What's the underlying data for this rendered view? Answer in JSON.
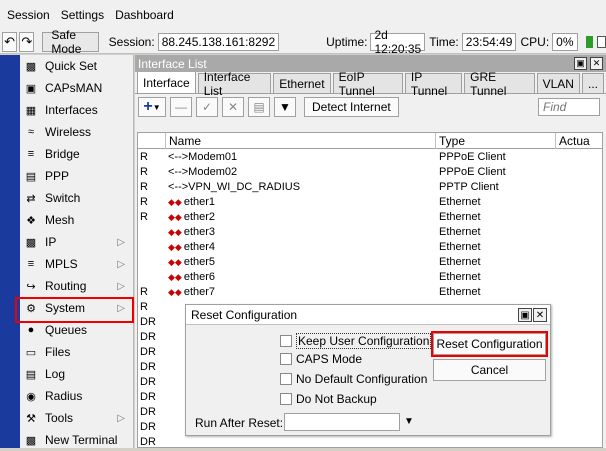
{
  "menubar": {
    "session": "Session",
    "settings": "Settings",
    "dashboard": "Dashboard"
  },
  "toolbar": {
    "undo_icon": "undo-icon",
    "redo_icon": "redo-icon",
    "safe_mode": "Safe Mode",
    "session_label": "Session:",
    "session_value": "88.245.138.161:8292",
    "uptime_label": "Uptime:",
    "uptime_value": "2d 12:20:35",
    "time_label": "Time:",
    "time_value": "23:54:49",
    "cpu_label": "CPU:",
    "cpu_value": "0%"
  },
  "nav": [
    {
      "label": "Quick Set",
      "icon": "quick-set-icon",
      "arrow": false
    },
    {
      "label": "CAPsMAN",
      "icon": "capsman-icon",
      "arrow": false
    },
    {
      "label": "Interfaces",
      "icon": "interfaces-icon",
      "arrow": false
    },
    {
      "label": "Wireless",
      "icon": "wireless-icon",
      "arrow": false
    },
    {
      "label": "Bridge",
      "icon": "bridge-icon",
      "arrow": false
    },
    {
      "label": "PPP",
      "icon": "ppp-icon",
      "arrow": false
    },
    {
      "label": "Switch",
      "icon": "switch-icon",
      "arrow": false
    },
    {
      "label": "Mesh",
      "icon": "mesh-icon",
      "arrow": false
    },
    {
      "label": "IP",
      "icon": "ip-icon",
      "arrow": true
    },
    {
      "label": "MPLS",
      "icon": "mpls-icon",
      "arrow": true
    },
    {
      "label": "Routing",
      "icon": "routing-icon",
      "arrow": true
    },
    {
      "label": "System",
      "icon": "system-icon",
      "arrow": true
    },
    {
      "label": "Queues",
      "icon": "queues-icon",
      "arrow": false
    },
    {
      "label": "Files",
      "icon": "files-icon",
      "arrow": false
    },
    {
      "label": "Log",
      "icon": "log-icon",
      "arrow": false
    },
    {
      "label": "Radius",
      "icon": "radius-icon",
      "arrow": false
    },
    {
      "label": "Tools",
      "icon": "tools-icon",
      "arrow": true
    },
    {
      "label": "New Terminal",
      "icon": "terminal-icon",
      "arrow": false
    }
  ],
  "interface_list": {
    "title": "Interface List",
    "tabs": [
      "Interface",
      "Interface List",
      "Ethernet",
      "EoIP Tunnel",
      "IP Tunnel",
      "GRE Tunnel",
      "VLAN",
      "..."
    ],
    "detect_button": "Detect Internet",
    "find_placeholder": "Find",
    "columns": {
      "name": "Name",
      "type": "Type",
      "actual": "Actua"
    },
    "rows": [
      {
        "flag": "R",
        "name": "<-->Modem01",
        "type": "PPPoE Client",
        "icon": "ppp"
      },
      {
        "flag": "R",
        "name": "<-->Modem02",
        "type": "PPPoE Client",
        "icon": "ppp"
      },
      {
        "flag": "R",
        "name": "<-->VPN_WI_DC_RADIUS",
        "type": "PPTP Client",
        "icon": "ppp"
      },
      {
        "flag": "R",
        "name": "ether1",
        "type": "Ethernet",
        "icon": "eth"
      },
      {
        "flag": "R",
        "name": "ether2",
        "type": "Ethernet",
        "icon": "eth"
      },
      {
        "flag": "",
        "name": "ether3",
        "type": "Ethernet",
        "icon": "eth"
      },
      {
        "flag": "",
        "name": "ether4",
        "type": "Ethernet",
        "icon": "eth"
      },
      {
        "flag": "",
        "name": "ether5",
        "type": "Ethernet",
        "icon": "eth"
      },
      {
        "flag": "",
        "name": "ether6",
        "type": "Ethernet",
        "icon": "eth"
      },
      {
        "flag": "R",
        "name": "ether7",
        "type": "Ethernet",
        "icon": "eth"
      },
      {
        "flag": "R",
        "name": "",
        "type": "",
        "icon": ""
      },
      {
        "flag": "DR",
        "name": "",
        "type": "",
        "icon": ""
      },
      {
        "flag": "DR",
        "name": "",
        "type": "",
        "icon": ""
      },
      {
        "flag": "DR",
        "name": "",
        "type": "",
        "icon": ""
      },
      {
        "flag": "DR",
        "name": "",
        "type": "",
        "icon": ""
      },
      {
        "flag": "DR",
        "name": "",
        "type": "",
        "icon": ""
      },
      {
        "flag": "DR",
        "name": "",
        "type": "",
        "icon": ""
      },
      {
        "flag": "DR",
        "name": "",
        "type": "",
        "icon": ""
      },
      {
        "flag": "DR",
        "name": "",
        "type": "",
        "icon": ""
      },
      {
        "flag": "DR",
        "name": "",
        "type": "",
        "icon": ""
      },
      {
        "flag": "DR",
        "name": "",
        "type": "",
        "icon": ""
      }
    ]
  },
  "dialog": {
    "title": "Reset Configuration",
    "options": [
      {
        "label": "Keep User Configuration",
        "checked": false
      },
      {
        "label": "CAPS Mode",
        "checked": false
      },
      {
        "label": "No Default Configuration",
        "checked": false
      },
      {
        "label": "Do Not Backup",
        "checked": false
      }
    ],
    "reset_button": "Reset Configuration",
    "cancel_button": "Cancel",
    "run_after_label": "Run After Reset:",
    "run_after_value": ""
  },
  "colors": {
    "sidebar": "#1b3a9e",
    "highlight": "#e00000",
    "title_bar": "#a9a9a9"
  }
}
